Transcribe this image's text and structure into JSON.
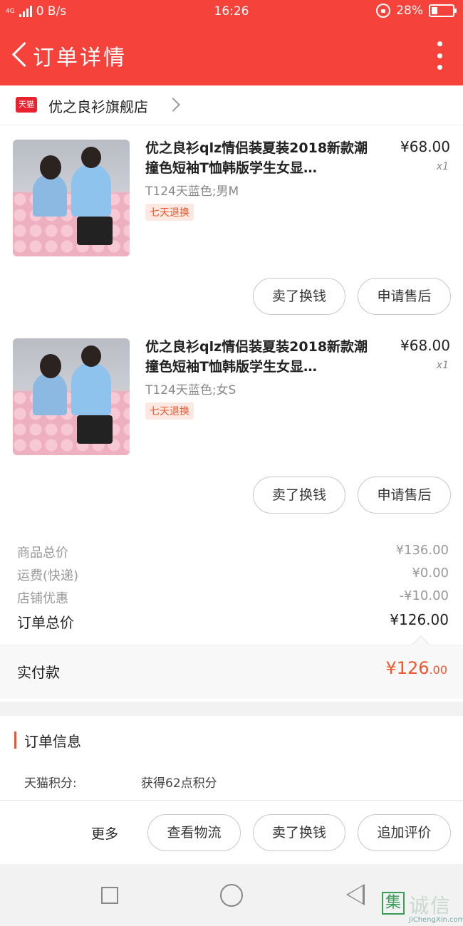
{
  "status_bar": {
    "network": "4G",
    "speed": "0 B/s",
    "time": "16:26",
    "battery": "28%",
    "battery_level": 0.28
  },
  "nav": {
    "title": "订单详情"
  },
  "shop": {
    "badge": "天猫",
    "name": "优之良衫旗舰店"
  },
  "items": [
    {
      "title": "优之良衫qlz情侣装夏装2018新款潮撞色短袖T恤韩版学生女显…",
      "price": "¥68.00",
      "qty": "x1",
      "spec": "T124天蓝色;男M",
      "tag": "七天退换",
      "btn_sell": "卖了换钱",
      "btn_aftersale": "申请售后"
    },
    {
      "title": "优之良衫qlz情侣装夏装2018新款潮撞色短袖T恤韩版学生女显…",
      "price": "¥68.00",
      "qty": "x1",
      "spec": "T124天蓝色;女S",
      "tag": "七天退换",
      "btn_sell": "卖了换钱",
      "btn_aftersale": "申请售后"
    }
  ],
  "summary": {
    "goods_label": "商品总价",
    "goods_value": "¥136.00",
    "shipping_label": "运费(快递)",
    "shipping_value": "¥0.00",
    "discount_label": "店铺优惠",
    "discount_value": "-¥10.00",
    "total_label": "订单总价",
    "total_value": "¥126.00"
  },
  "paid": {
    "label": "实付款",
    "amount_int": "¥126",
    "amount_dec": ".00"
  },
  "order_info": {
    "title": "订单信息",
    "points_label": "天猫积分:",
    "points_value": "获得62点积分"
  },
  "actions": {
    "more": "更多",
    "logistics": "查看物流",
    "sell": "卖了换钱",
    "review": "追加评价"
  },
  "watermark": {
    "logo": "集",
    "cn": "诚信",
    "en": "JiChengXin.com"
  },
  "colors": {
    "brand_red": "#f5433c",
    "accent_orange": "#f0552b"
  }
}
